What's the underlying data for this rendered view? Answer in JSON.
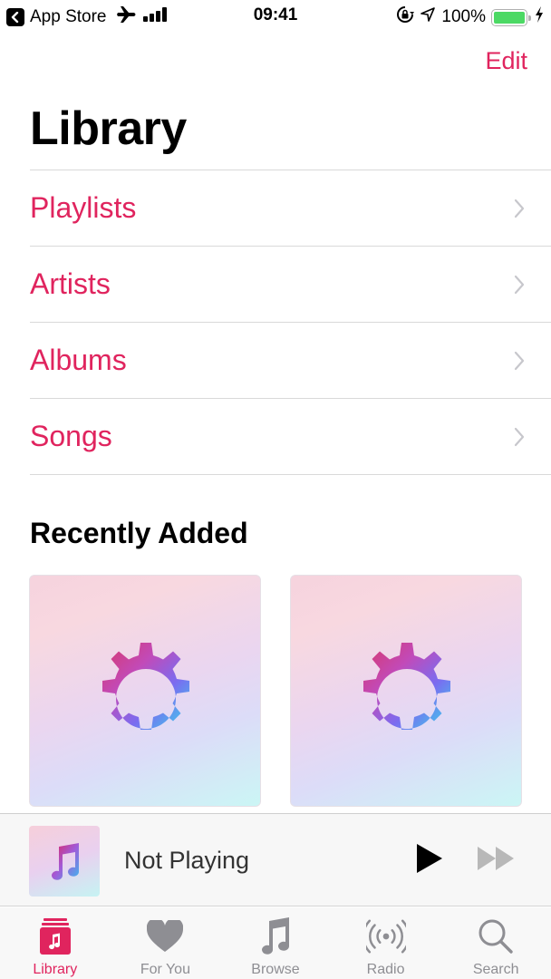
{
  "status_bar": {
    "back_app": "App Store",
    "time": "09:41",
    "battery_percent": "100%",
    "battery_level": 1.0,
    "icons": [
      "back-chevron-icon",
      "airplane-icon",
      "signal-icon",
      "orientation-lock-icon",
      "location-icon",
      "battery-icon",
      "charging-bolt-icon"
    ]
  },
  "header": {
    "edit_label": "Edit",
    "title": "Library"
  },
  "nav_items": [
    {
      "label": "Playlists"
    },
    {
      "label": "Artists"
    },
    {
      "label": "Albums"
    },
    {
      "label": "Songs"
    }
  ],
  "recently_added": {
    "title": "Recently Added",
    "albums": [
      {
        "artwork_icon": "gear-icon"
      },
      {
        "artwork_icon": "gear-icon"
      }
    ]
  },
  "mini_player": {
    "title": "Not Playing",
    "artwork_icon": "music-note-icon",
    "play_icon": "play-icon",
    "forward_icon": "fast-forward-icon"
  },
  "tab_bar": {
    "active": "Library",
    "tabs": [
      {
        "label": "Library",
        "icon": "library-icon"
      },
      {
        "label": "For You",
        "icon": "heart-icon"
      },
      {
        "label": "Browse",
        "icon": "music-note-icon"
      },
      {
        "label": "Radio",
        "icon": "radio-icon"
      },
      {
        "label": "Search",
        "icon": "search-icon"
      }
    ]
  },
  "colors": {
    "accent": "#e0245e",
    "battery": "#4cd964",
    "inactive_tab": "#8e8e93"
  }
}
